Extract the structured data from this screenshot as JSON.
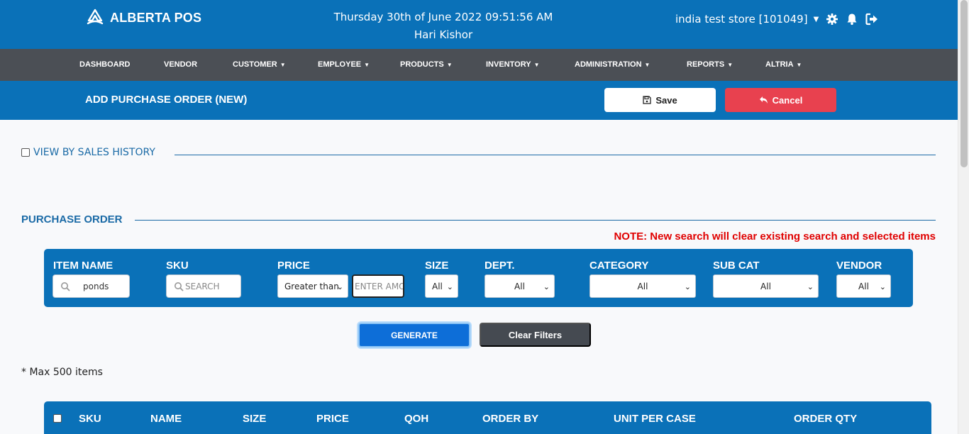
{
  "header": {
    "brand": "ALBERTA POS",
    "datetime": "Thursday 30th of June 2022 09:51:56 AM",
    "user": "Hari Kishor",
    "store": "india test store [101049]",
    "brand_color": "#0a71b8"
  },
  "nav": {
    "items": [
      {
        "label": "DASHBOARD",
        "dropdown": false
      },
      {
        "label": "VENDOR",
        "dropdown": false
      },
      {
        "label": "CUSTOMER",
        "dropdown": true
      },
      {
        "label": "EMPLOYEE",
        "dropdown": true
      },
      {
        "label": "PRODUCTS",
        "dropdown": true
      },
      {
        "label": "INVENTORY",
        "dropdown": true
      },
      {
        "label": "ADMINISTRATION",
        "dropdown": true
      },
      {
        "label": "REPORTS",
        "dropdown": true
      },
      {
        "label": "ALTRIA",
        "dropdown": true
      }
    ]
  },
  "page": {
    "title": "ADD PURCHASE ORDER (NEW)",
    "save_label": "Save",
    "cancel_label": "Cancel"
  },
  "sales_history": {
    "label": "VIEW BY SALES HISTORY",
    "checked": false
  },
  "purchase_order": {
    "section_title": "PURCHASE ORDER",
    "note": "NOTE: New search will clear existing search and selected items"
  },
  "filters": {
    "item_name": {
      "label": "ITEM NAME",
      "value": "ponds"
    },
    "sku": {
      "label": "SKU",
      "placeholder": "SEARCH"
    },
    "price": {
      "label": "PRICE",
      "operator": "Greater than",
      "amount_placeholder": "ENTER AMOUNT"
    },
    "size": {
      "label": "SIZE",
      "value": "All"
    },
    "dept": {
      "label": "DEPT.",
      "value": "All"
    },
    "category": {
      "label": "CATEGORY",
      "value": "All"
    },
    "sub_cat": {
      "label": "SUB CAT",
      "value": "All"
    },
    "vendor": {
      "label": "VENDOR",
      "value": "All"
    }
  },
  "actions": {
    "generate_label": "GENERATE",
    "clear_label": "Clear Filters",
    "max_note": "* Max 500 items"
  },
  "table": {
    "columns": [
      "SKU",
      "NAME",
      "SIZE",
      "PRICE",
      "QOH",
      "ORDER BY",
      "UNIT PER CASE",
      "ORDER QTY"
    ]
  }
}
